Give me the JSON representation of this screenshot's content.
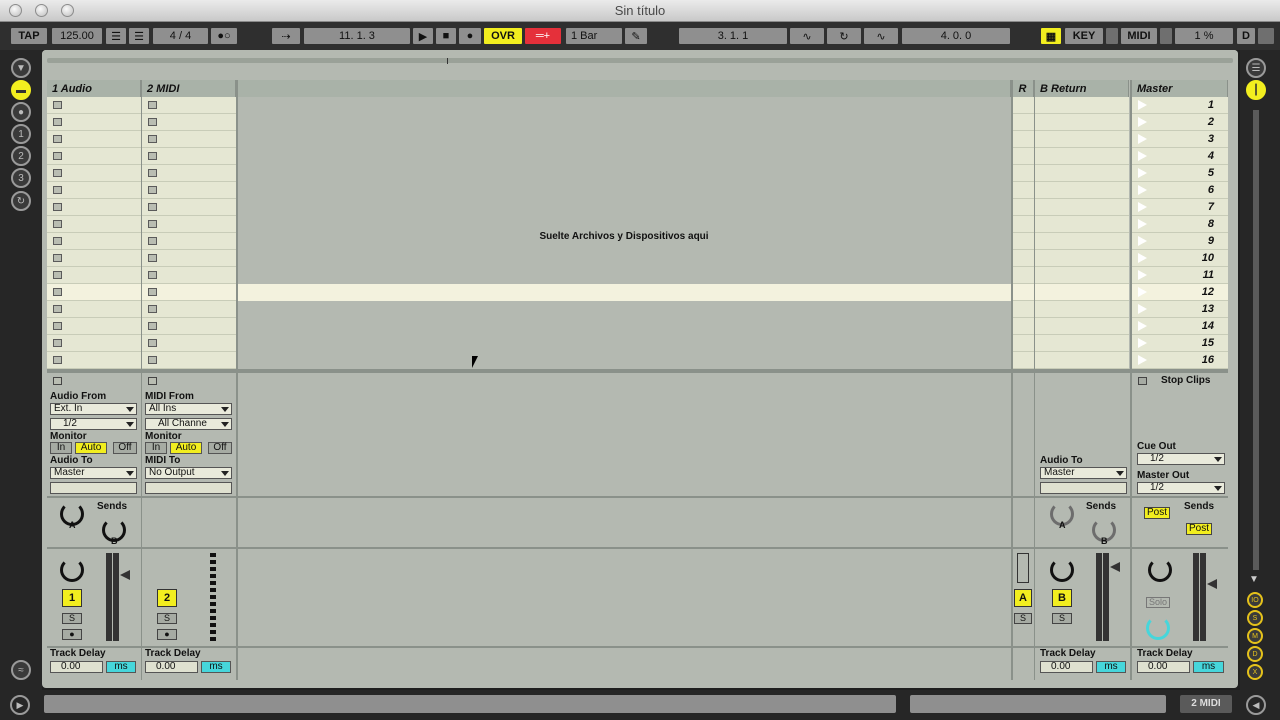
{
  "window": {
    "title": "Sin título"
  },
  "transport": {
    "tap": "TAP",
    "tempo": "125.00",
    "sig": "4 / 4",
    "position": "11.    1.    3",
    "ovr": "OVR",
    "quantize": "1 Bar",
    "loop_start": "3.    1.    1",
    "loop_length": "4.    0.    0",
    "key": "KEY",
    "midi": "MIDI",
    "cpu": "1 %",
    "disk": "D"
  },
  "tracks": [
    {
      "name": "1 Audio",
      "from_label": "Audio From",
      "from_value": "Ext. In",
      "channel": "1/2",
      "monitor_label": "Monitor",
      "monitor": [
        "In",
        "Auto",
        "Off"
      ],
      "to_label": "Audio To",
      "to_value": "Master",
      "sends_label": "Sends",
      "number": "1",
      "solo": "S",
      "delay_label": "Track Delay",
      "delay_value": "0.00",
      "delay_unit": "ms"
    },
    {
      "name": "2 MIDI",
      "from_label": "MIDI From",
      "from_value": "All Ins",
      "channel": "All Channe",
      "monitor_label": "Monitor",
      "monitor": [
        "In",
        "Auto",
        "Off"
      ],
      "to_label": "MIDI To",
      "to_value": "No Output",
      "number": "2",
      "solo": "S",
      "delay_label": "Track Delay",
      "delay_value": "0.00",
      "delay_unit": "ms"
    }
  ],
  "drop_hint": "Suelte Archivos y Dispositivos aqui",
  "returns": {
    "r_label": "R",
    "a_letter": "A",
    "a_solo": "S",
    "b_name": "B Return",
    "to_label": "Audio To",
    "to_value": "Master",
    "sends_label": "Sends",
    "b_letter": "B",
    "b_solo": "S",
    "delay_label": "Track Delay",
    "delay_value": "0.00",
    "delay_unit": "ms"
  },
  "master": {
    "name": "Master",
    "scenes": [
      "1",
      "2",
      "3",
      "4",
      "5",
      "6",
      "7",
      "8",
      "9",
      "10",
      "11",
      "12",
      "13",
      "14",
      "15",
      "16"
    ],
    "selected_scene": "12",
    "stop_clips": "Stop Clips",
    "cue_out_label": "Cue Out",
    "cue_out_value": "1/2",
    "master_out_label": "Master Out",
    "master_out_value": "1/2",
    "sends_label": "Sends",
    "post1": "Post",
    "post2": "Post",
    "solo_label": "Solo",
    "delay_label": "Track Delay",
    "delay_value": "0.00",
    "delay_unit": "ms"
  },
  "status": {
    "selected_track": "2 MIDI"
  },
  "colors": {
    "accent_yellow": "#f2ee1f",
    "accent_cyan": "#46d6db",
    "record_red": "#e5303a",
    "clip_bg": "#e5e7d3",
    "panel_bg": "#b4b9b1"
  }
}
